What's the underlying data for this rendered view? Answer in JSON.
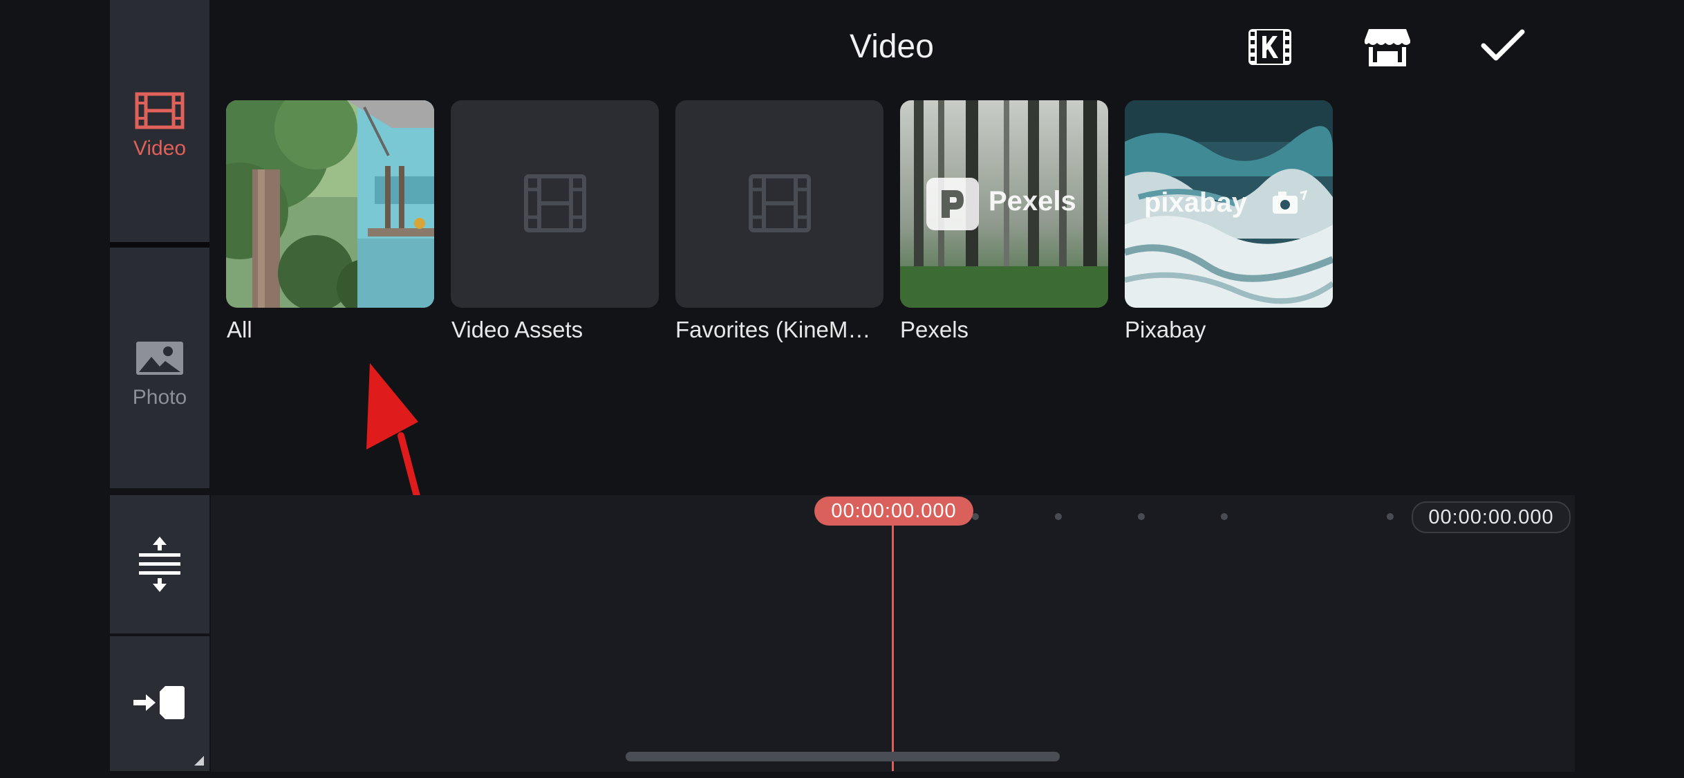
{
  "sidebar": {
    "tabs": [
      {
        "label": "Video",
        "icon": "film-icon",
        "active": true,
        "color": "#e0605a"
      },
      {
        "label": "Photo",
        "icon": "image-icon",
        "active": false,
        "color": "#8e9097"
      }
    ],
    "tools": [
      {
        "icon": "expand-vertical-icon"
      },
      {
        "icon": "import-arrow-icon"
      }
    ]
  },
  "header": {
    "title": "Video",
    "actions": [
      {
        "icon": "kinemaster-logo-icon"
      },
      {
        "icon": "asset-store-icon"
      },
      {
        "icon": "checkmark-icon"
      }
    ]
  },
  "folders": [
    {
      "label": "All",
      "thumb": "illustration"
    },
    {
      "label": "Video Assets",
      "thumb": "placeholder-film"
    },
    {
      "label": "Favorites (KineM…",
      "thumb": "placeholder-film"
    },
    {
      "label": "Pexels",
      "thumb": "forest",
      "logo_text": "Pexels"
    },
    {
      "label": "Pixabay",
      "thumb": "ocean",
      "logo_text": "pixabay"
    }
  ],
  "timeline": {
    "playhead_time": "00:00:00.000",
    "end_time": "00:00:00.000"
  },
  "colors": {
    "accent": "#d9605b",
    "background": "#121316",
    "panel": "#2a2c33"
  }
}
